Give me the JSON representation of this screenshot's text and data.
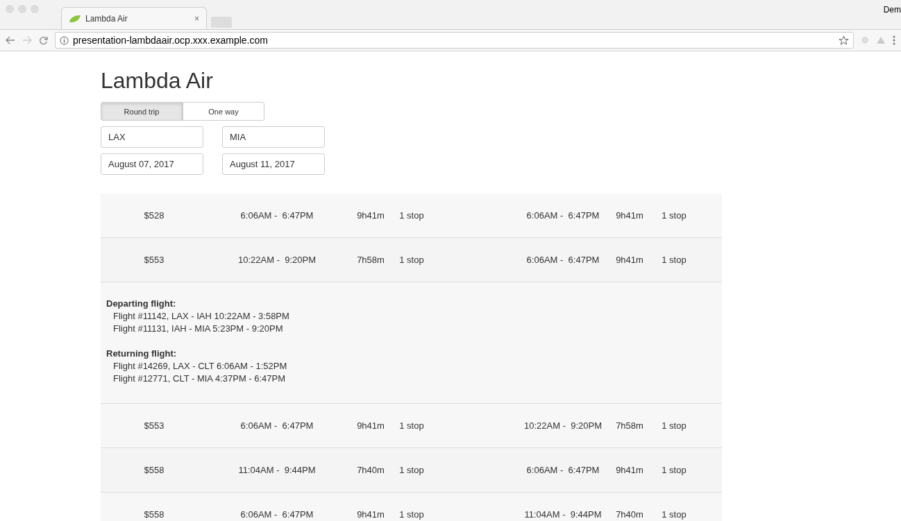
{
  "browser": {
    "tab_title": "Lambda Air",
    "close": "×",
    "profile": "Dem",
    "url": "presentation-lambdaair.ocp.xxx.example.com"
  },
  "title": "Lambda Air",
  "trip_types": [
    {
      "label": "Round trip",
      "selected": true
    },
    {
      "label": "One way",
      "selected": false
    }
  ],
  "search": {
    "from": "LAX",
    "to": "MIA",
    "depart_date": "August 07, 2017",
    "return_date": "August 11, 2017"
  },
  "results": [
    {
      "price": "$528",
      "depart": {
        "times": "6:06AM -  6:47PM",
        "duration": "9h41m",
        "stops": "1 stop"
      },
      "return": {
        "times": "6:06AM -  6:47PM",
        "duration": "9h41m",
        "stops": "1 stop"
      }
    },
    {
      "price": "$553",
      "depart": {
        "times": "10:22AM -  9:20PM",
        "duration": "7h58m",
        "stops": "1 stop"
      },
      "return": {
        "times": "6:06AM -  6:47PM",
        "duration": "9h41m",
        "stops": "1 stop"
      },
      "details": [
        {
          "heading": "Departing flight:",
          "legs": [
            "Flight #11142, LAX - IAH 10:22AM - 3:58PM",
            "Flight #11131, IAH - MIA 5:23PM - 9:20PM"
          ]
        },
        {
          "heading": "Returning flight:",
          "legs": [
            "Flight #14269, LAX - CLT 6:06AM - 1:52PM",
            "Flight #12771, CLT - MIA 4:37PM - 6:47PM"
          ]
        }
      ]
    },
    {
      "price": "$553",
      "depart": {
        "times": "6:06AM -  6:47PM",
        "duration": "9h41m",
        "stops": "1 stop"
      },
      "return": {
        "times": "10:22AM -  9:20PM",
        "duration": "7h58m",
        "stops": "1 stop"
      }
    },
    {
      "price": "$558",
      "depart": {
        "times": "11:04AM -  9:44PM",
        "duration": "7h40m",
        "stops": "1 stop"
      },
      "return": {
        "times": "6:06AM -  6:47PM",
        "duration": "9h41m",
        "stops": "1 stop"
      }
    },
    {
      "price": "$558",
      "depart": {
        "times": "6:06AM -  6:47PM",
        "duration": "9h41m",
        "stops": "1 stop"
      },
      "return": {
        "times": "11:04AM -  9:44PM",
        "duration": "7h40m",
        "stops": "1 stop"
      }
    }
  ]
}
